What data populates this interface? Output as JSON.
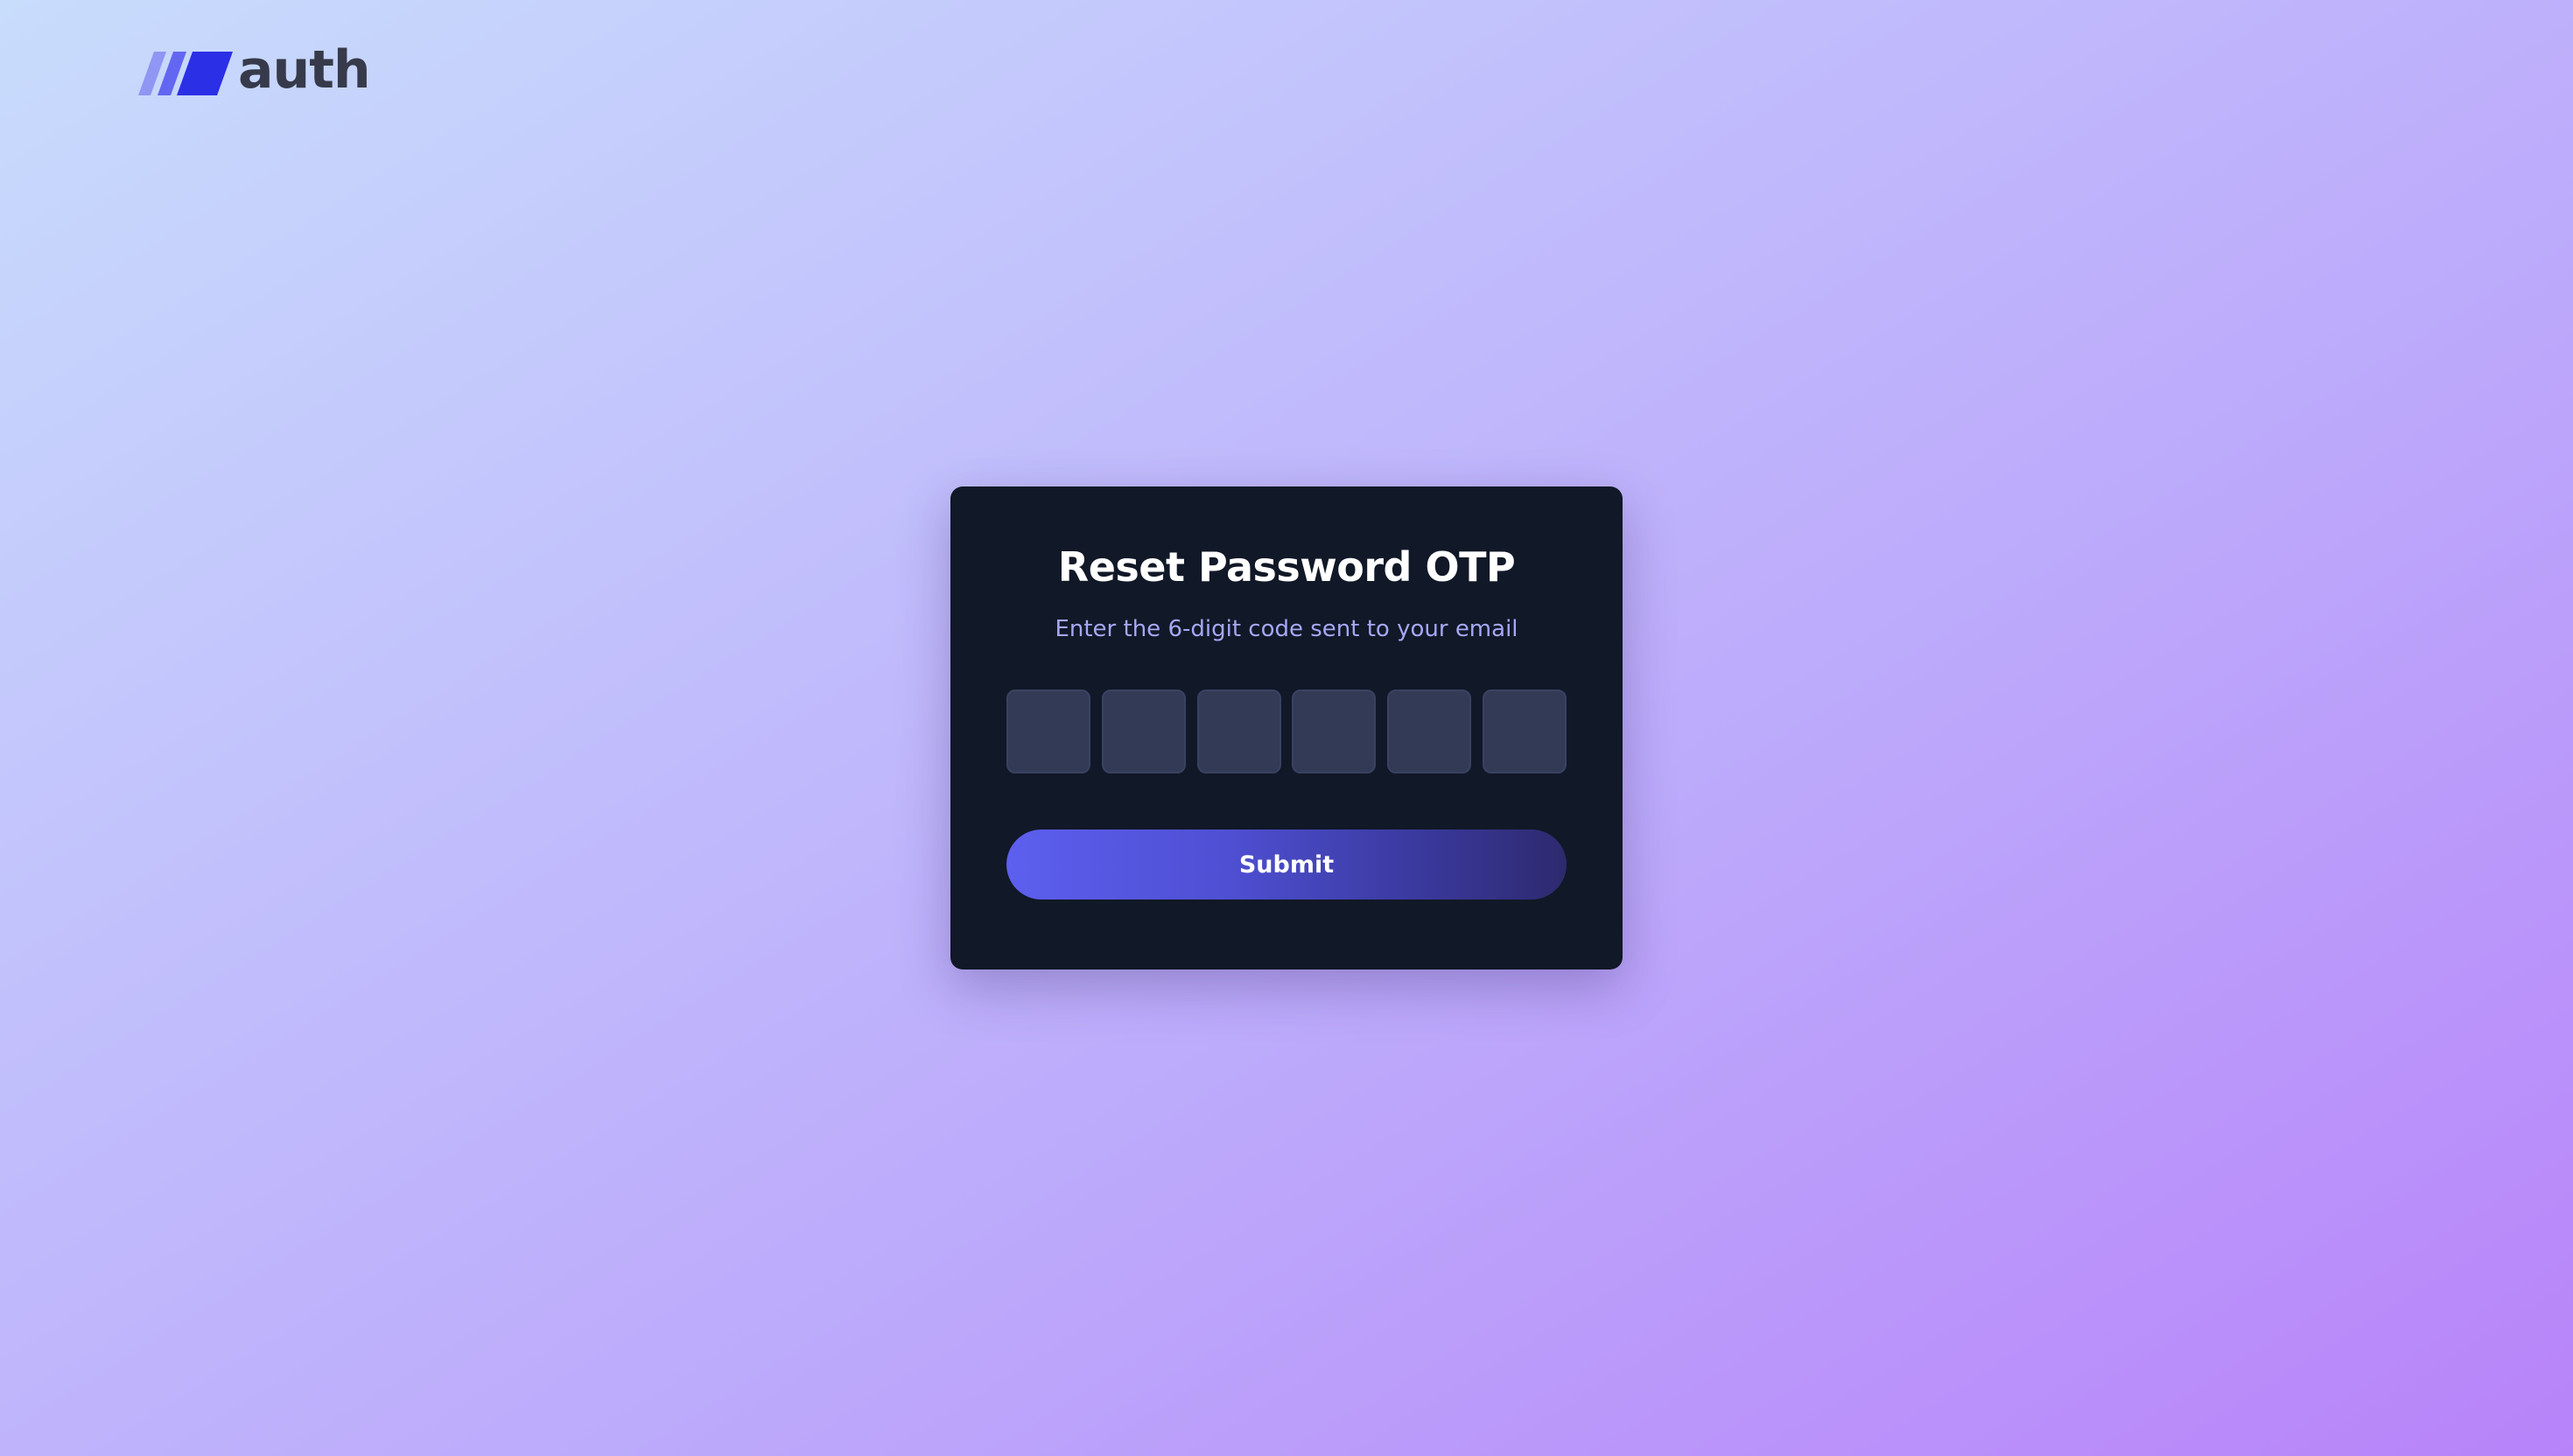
{
  "logo": {
    "text": "auth",
    "icon": "stripes-logo-icon",
    "colors": [
      "#8f96f3",
      "#6366f1",
      "#2b2fe6"
    ]
  },
  "card": {
    "title": "Reset Password OTP",
    "subtitle": "Enter the 6-digit code sent to your email",
    "otp_digits": [
      "",
      "",
      "",
      "",
      "",
      ""
    ],
    "submit_label": "Submit"
  },
  "colors": {
    "card_background": "#111827",
    "subtitle": "#a5a8f5",
    "otp_box": "#333a55",
    "button_start": "#5d5fef",
    "button_end": "#2d2a6e"
  }
}
